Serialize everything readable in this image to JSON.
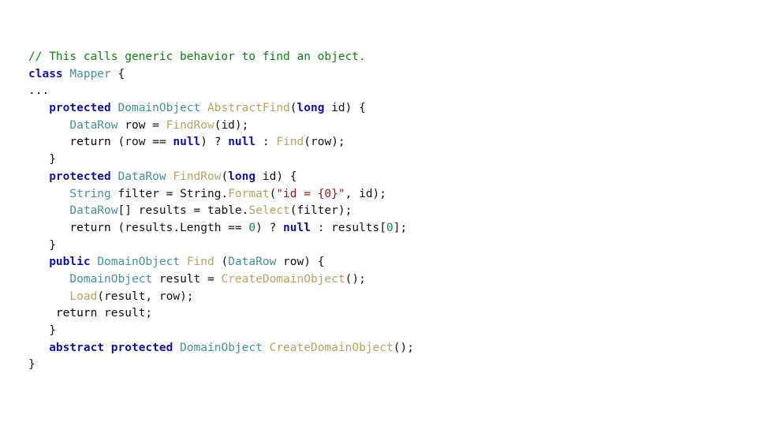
{
  "editor": {
    "background_color": "#ffffff",
    "language": "csharp",
    "palette": {
      "plain": "#111111",
      "comment": "#1a7a1a",
      "keyword": "#15158c",
      "type": "#4a8f96",
      "method": "#b3a46a",
      "return_keyword": "#8e3a9e",
      "string": "#8b1a1a",
      "number": "#1f7a5a"
    },
    "plain_text": "// This calls generic behavior to find an object.\nclass Mapper {\n...\n   protected DomainObject AbstractFind(long id) {\n      DataRow row = FindRow(id);\n      return (row == null) ? null : Find(row);\n   }\n   protected DataRow FindRow(long id) {\n      String filter = String.Format(\"id = {0}\", id);\n      DataRow[] results = table.Select(filter);\n      return (results.Length == 0) ? null : results[0];\n   }\n   public DomainObject Find (DataRow row) {\n      DomainObject result = CreateDomainObject();\n      Load(result, row);\n    return result;\n   }\n   abstract protected DomainObject CreateDomainObject();\n}",
    "lines": [
      {
        "id": "line-1",
        "tokens": [
          {
            "t": "// This calls generic behavior to find an object.",
            "c": "comment"
          }
        ]
      },
      {
        "id": "line-2",
        "tokens": [
          {
            "t": "class",
            "c": "keyword"
          },
          {
            "t": " ",
            "c": "plain"
          },
          {
            "t": "Mapper",
            "c": "type"
          },
          {
            "t": " {",
            "c": "punct"
          }
        ]
      },
      {
        "id": "line-3",
        "tokens": [
          {
            "t": "...",
            "c": "plain"
          }
        ]
      },
      {
        "id": "line-4",
        "tokens": [
          {
            "t": "   ",
            "c": "plain"
          },
          {
            "t": "protected",
            "c": "keyword"
          },
          {
            "t": " ",
            "c": "plain"
          },
          {
            "t": "DomainObject",
            "c": "type"
          },
          {
            "t": " ",
            "c": "plain"
          },
          {
            "t": "AbstractFind",
            "c": "method"
          },
          {
            "t": "(",
            "c": "punct"
          },
          {
            "t": "long",
            "c": "keyword"
          },
          {
            "t": " id",
            "c": "plain"
          },
          {
            "t": ") {",
            "c": "punct"
          }
        ]
      },
      {
        "id": "line-5",
        "tokens": [
          {
            "t": "      ",
            "c": "plain"
          },
          {
            "t": "DataRow",
            "c": "type"
          },
          {
            "t": " row = ",
            "c": "plain"
          },
          {
            "t": "FindRow",
            "c": "method"
          },
          {
            "t": "(",
            "c": "punct"
          },
          {
            "t": "id",
            "c": "plain"
          },
          {
            "t": ");",
            "c": "punct"
          }
        ]
      },
      {
        "id": "line-6",
        "tokens": [
          {
            "t": "      ",
            "c": "plain"
          },
          {
            "t": "return",
            "c": "return_keyword"
          },
          {
            "t": " (row == ",
            "c": "plain"
          },
          {
            "t": "null",
            "c": "keyword"
          },
          {
            "t": ") ? ",
            "c": "plain"
          },
          {
            "t": "null",
            "c": "keyword"
          },
          {
            "t": " : ",
            "c": "plain"
          },
          {
            "t": "Find",
            "c": "method"
          },
          {
            "t": "(",
            "c": "punct"
          },
          {
            "t": "row",
            "c": "plain"
          },
          {
            "t": ");",
            "c": "punct"
          }
        ]
      },
      {
        "id": "line-7",
        "tokens": [
          {
            "t": "   }",
            "c": "punct"
          }
        ]
      },
      {
        "id": "line-8",
        "tokens": [
          {
            "t": "   ",
            "c": "plain"
          },
          {
            "t": "protected",
            "c": "keyword"
          },
          {
            "t": " ",
            "c": "plain"
          },
          {
            "t": "DataRow",
            "c": "type"
          },
          {
            "t": " ",
            "c": "plain"
          },
          {
            "t": "FindRow",
            "c": "method"
          },
          {
            "t": "(",
            "c": "punct"
          },
          {
            "t": "long",
            "c": "keyword"
          },
          {
            "t": " id",
            "c": "plain"
          },
          {
            "t": ") {",
            "c": "punct"
          }
        ]
      },
      {
        "id": "line-9",
        "tokens": [
          {
            "t": "      ",
            "c": "plain"
          },
          {
            "t": "String",
            "c": "type"
          },
          {
            "t": " filter = String.",
            "c": "plain"
          },
          {
            "t": "Format",
            "c": "method"
          },
          {
            "t": "(",
            "c": "punct"
          },
          {
            "t": "\"id = {0}\"",
            "c": "string"
          },
          {
            "t": ", id);",
            "c": "plain"
          }
        ]
      },
      {
        "id": "line-10",
        "tokens": [
          {
            "t": "      ",
            "c": "plain"
          },
          {
            "t": "DataRow",
            "c": "type"
          },
          {
            "t": "[] results = table.",
            "c": "plain"
          },
          {
            "t": "Select",
            "c": "method"
          },
          {
            "t": "(",
            "c": "punct"
          },
          {
            "t": "filter",
            "c": "plain"
          },
          {
            "t": ");",
            "c": "punct"
          }
        ]
      },
      {
        "id": "line-11",
        "tokens": [
          {
            "t": "      ",
            "c": "plain"
          },
          {
            "t": "return",
            "c": "return_keyword"
          },
          {
            "t": " (results.Length == ",
            "c": "plain"
          },
          {
            "t": "0",
            "c": "number"
          },
          {
            "t": ") ? ",
            "c": "plain"
          },
          {
            "t": "null",
            "c": "keyword"
          },
          {
            "t": " : results[",
            "c": "plain"
          },
          {
            "t": "0",
            "c": "number"
          },
          {
            "t": "];",
            "c": "plain"
          }
        ]
      },
      {
        "id": "line-12",
        "tokens": [
          {
            "t": "   }",
            "c": "punct"
          }
        ]
      },
      {
        "id": "line-13",
        "tokens": [
          {
            "t": "   ",
            "c": "plain"
          },
          {
            "t": "public",
            "c": "keyword"
          },
          {
            "t": " ",
            "c": "plain"
          },
          {
            "t": "DomainObject",
            "c": "type"
          },
          {
            "t": " ",
            "c": "plain"
          },
          {
            "t": "Find",
            "c": "method"
          },
          {
            "t": " (",
            "c": "punct"
          },
          {
            "t": "DataRow",
            "c": "type"
          },
          {
            "t": " row",
            "c": "plain"
          },
          {
            "t": ") {",
            "c": "punct"
          }
        ]
      },
      {
        "id": "line-14",
        "tokens": [
          {
            "t": "      ",
            "c": "plain"
          },
          {
            "t": "DomainObject",
            "c": "type"
          },
          {
            "t": " result = ",
            "c": "plain"
          },
          {
            "t": "CreateDomainObject",
            "c": "method"
          },
          {
            "t": "();",
            "c": "punct"
          }
        ]
      },
      {
        "id": "line-15",
        "tokens": [
          {
            "t": "      ",
            "c": "plain"
          },
          {
            "t": "Load",
            "c": "method"
          },
          {
            "t": "(",
            "c": "punct"
          },
          {
            "t": "result, row",
            "c": "plain"
          },
          {
            "t": ");",
            "c": "punct"
          }
        ]
      },
      {
        "id": "line-16",
        "tokens": [
          {
            "t": "    ",
            "c": "plain"
          },
          {
            "t": "return",
            "c": "return_keyword"
          },
          {
            "t": " result;",
            "c": "plain"
          }
        ]
      },
      {
        "id": "line-17",
        "tokens": [
          {
            "t": "   }",
            "c": "punct"
          }
        ]
      },
      {
        "id": "line-18",
        "tokens": [
          {
            "t": "   ",
            "c": "plain"
          },
          {
            "t": "abstract",
            "c": "keyword"
          },
          {
            "t": " ",
            "c": "plain"
          },
          {
            "t": "protected",
            "c": "keyword"
          },
          {
            "t": " ",
            "c": "plain"
          },
          {
            "t": "DomainObject",
            "c": "type"
          },
          {
            "t": " ",
            "c": "plain"
          },
          {
            "t": "CreateDomainObject",
            "c": "method"
          },
          {
            "t": "();",
            "c": "punct"
          }
        ]
      },
      {
        "id": "line-19",
        "tokens": [
          {
            "t": "}",
            "c": "punct"
          }
        ]
      }
    ]
  }
}
